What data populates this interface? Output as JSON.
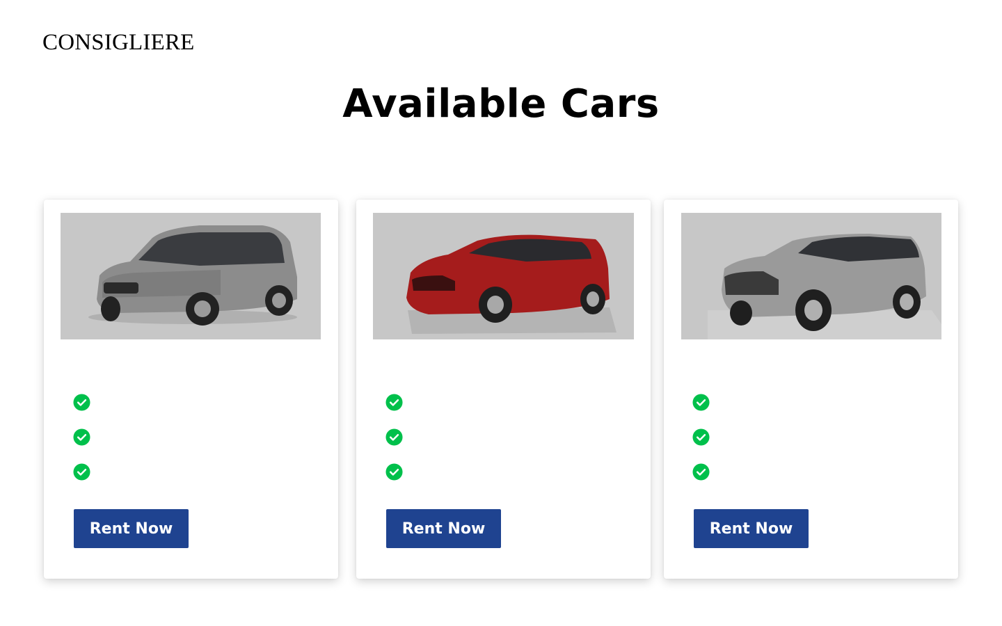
{
  "brand": "CONSIGLIERE",
  "title": "Available Cars",
  "colors": {
    "button": "#1f4390",
    "check": "#00c04b",
    "image_bg": "#c7c7c7"
  },
  "cars": [
    {
      "image": "car-image-silver-mpv",
      "features": [
        "",
        "",
        ""
      ],
      "button_label": "Rent Now"
    },
    {
      "image": "car-image-red-hatchback",
      "features": [
        "",
        "",
        ""
      ],
      "button_label": "Rent Now"
    },
    {
      "image": "car-image-silver-suv",
      "features": [
        "",
        "",
        ""
      ],
      "button_label": "Rent Now"
    }
  ]
}
